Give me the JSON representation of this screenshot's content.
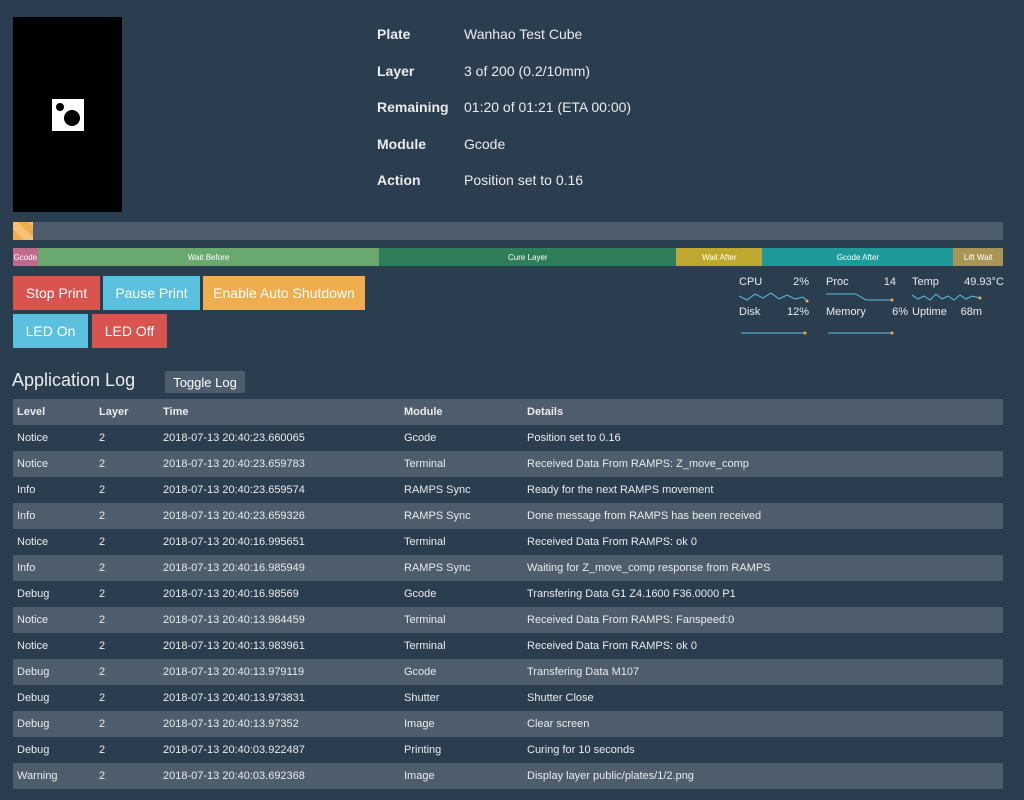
{
  "info": [
    {
      "key": "Plate",
      "value": "Wanhao Test Cube"
    },
    {
      "key": "Layer",
      "value": "3 of 200 (0.2/10mm)"
    },
    {
      "key": "Remaining",
      "value": "01:20 of 01:21 (ETA 00:00)"
    },
    {
      "key": "Module",
      "value": "Gcode"
    },
    {
      "key": "Action",
      "value": "Position set to 0.16"
    }
  ],
  "progress": {
    "percent": 2,
    "color": "#f0ad4e"
  },
  "stages": [
    {
      "label": "Gcode",
      "percent": 2.5,
      "color": "#c06a8b"
    },
    {
      "label": "Wait Before",
      "percent": 34.5,
      "color": "#6aa870"
    },
    {
      "label": "Cure Layer",
      "percent": 30.0,
      "color": "#2e7d5b"
    },
    {
      "label": "Wait After",
      "percent": 8.7,
      "color": "#bfa830"
    },
    {
      "label": "Gcode After",
      "percent": 19.3,
      "color": "#1e9a9a"
    },
    {
      "label": "Lift Wait",
      "percent": 5.0,
      "color": "#a89555"
    }
  ],
  "buttons": {
    "stop_print": "Stop Print",
    "pause_print": "Pause Print",
    "auto_shutdown": "Enable Auto Shutdown",
    "led_on": "LED On",
    "led_off": "LED Off"
  },
  "stats": {
    "cpu": {
      "label": "CPU",
      "value": "2%"
    },
    "proc": {
      "label": "Proc",
      "value": "14"
    },
    "temp": {
      "label": "Temp",
      "value": "49.93°C"
    },
    "disk": {
      "label": "Disk",
      "value": "12%"
    },
    "memory": {
      "label": "Memory",
      "value": "6%"
    },
    "uptime": {
      "label": "Uptime",
      "value": "68m"
    }
  },
  "log": {
    "title": "Application Log",
    "toggle_label": "Toggle Log",
    "columns": [
      "Level",
      "Layer",
      "Time",
      "Module",
      "Details"
    ],
    "rows": [
      [
        "Notice",
        "2",
        "2018-07-13 20:40:23.660065",
        "Gcode",
        "Position set to 0.16"
      ],
      [
        "Notice",
        "2",
        "2018-07-13 20:40:23.659783",
        "Terminal",
        "Received Data From RAMPS: Z_move_comp"
      ],
      [
        "Info",
        "2",
        "2018-07-13 20:40:23.659574",
        "RAMPS Sync",
        "Ready for the next RAMPS movement"
      ],
      [
        "Info",
        "2",
        "2018-07-13 20:40:23.659326",
        "RAMPS Sync",
        "Done message from RAMPS has been received"
      ],
      [
        "Notice",
        "2",
        "2018-07-13 20:40:16.995651",
        "Terminal",
        "Received Data From RAMPS: ok 0"
      ],
      [
        "Info",
        "2",
        "2018-07-13 20:40:16.985949",
        "RAMPS Sync",
        "Waiting for Z_move_comp response from RAMPS"
      ],
      [
        "Debug",
        "2",
        "2018-07-13 20:40:16.98569",
        "Gcode",
        "Transfering Data G1 Z4.1600 F36.0000 P1"
      ],
      [
        "Notice",
        "2",
        "2018-07-13 20:40:13.984459",
        "Terminal",
        "Received Data From RAMPS: Fanspeed:0"
      ],
      [
        "Notice",
        "2",
        "2018-07-13 20:40:13.983961",
        "Terminal",
        "Received Data From RAMPS: ok 0"
      ],
      [
        "Debug",
        "2",
        "2018-07-13 20:40:13.979119",
        "Gcode",
        "Transfering Data M107"
      ],
      [
        "Debug",
        "2",
        "2018-07-13 20:40:13.973831",
        "Shutter",
        "Shutter Close"
      ],
      [
        "Debug",
        "2",
        "2018-07-13 20:40:13.97352",
        "Image",
        "Clear screen"
      ],
      [
        "Debug",
        "2",
        "2018-07-13 20:40:03.922487",
        "Printing",
        "Curing for 10 seconds"
      ],
      [
        "Warning",
        "2",
        "2018-07-13 20:40:03.692368",
        "Image",
        "Display layer public/plates/1/2.png"
      ]
    ]
  }
}
